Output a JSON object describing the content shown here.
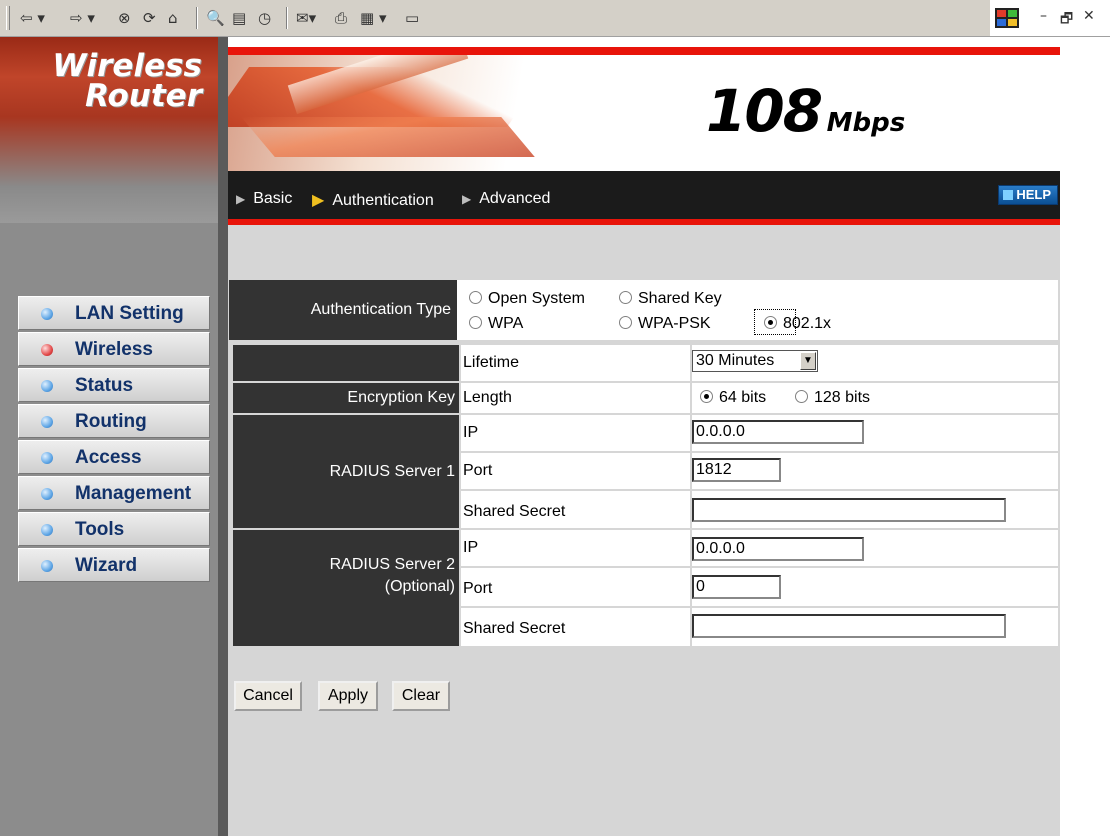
{
  "browser": {
    "toolbar_icons": [
      "back-icon",
      "forward-icon",
      "stop-icon",
      "refresh-icon",
      "home-icon",
      "search-icon",
      "favorites-icon",
      "history-icon",
      "mail-icon",
      "print-icon",
      "edit-icon",
      "discuss-icon"
    ],
    "window_controls": {
      "minimize": "–",
      "restore": "🗗",
      "close": "✕"
    }
  },
  "brand": {
    "line1": "Wireless",
    "line2": "Router",
    "speed": "108",
    "speed_unit": "Mbps"
  },
  "nav": {
    "items": [
      {
        "label": "Basic",
        "active": false
      },
      {
        "label": "Authentication",
        "active": true
      },
      {
        "label": "Advanced",
        "active": false
      }
    ],
    "help": "HELP"
  },
  "sidebar": {
    "items": [
      {
        "label": "LAN Setting",
        "active": false
      },
      {
        "label": "Wireless",
        "active": true
      },
      {
        "label": "Status",
        "active": false
      },
      {
        "label": "Routing",
        "active": false
      },
      {
        "label": "Access",
        "active": false
      },
      {
        "label": "Management",
        "active": false
      },
      {
        "label": "Tools",
        "active": false
      },
      {
        "label": "Wizard",
        "active": false
      }
    ]
  },
  "form": {
    "auth_type_label": "Authentication Type",
    "auth_options": [
      "Open System",
      "Shared Key",
      "WPA",
      "WPA-PSK",
      "802.1x"
    ],
    "auth_selected": "802.1x",
    "lifetime_label": "Lifetime",
    "lifetime_value": "30 Minutes",
    "enc_key_label": "Encryption Key",
    "length_label": "Length",
    "length_options": [
      "64 bits",
      "128 bits"
    ],
    "length_selected": "64 bits",
    "radius1_label": "RADIUS Server 1",
    "radius2_label_line1": "RADIUS Server 2",
    "radius2_label_line2": "(Optional)",
    "ip_label": "IP",
    "port_label": "Port",
    "secret_label": "Shared Secret",
    "radius1": {
      "ip": "0.0.0.0",
      "port": "1812",
      "secret": ""
    },
    "radius2": {
      "ip": "0.0.0.0",
      "port": "0",
      "secret": ""
    }
  },
  "buttons": {
    "cancel": "Cancel",
    "apply": "Apply",
    "clear": "Clear"
  },
  "colors": {
    "accent_red": "#e8140a",
    "dark_cell": "#333333",
    "content_bg": "#d6d6d6"
  }
}
